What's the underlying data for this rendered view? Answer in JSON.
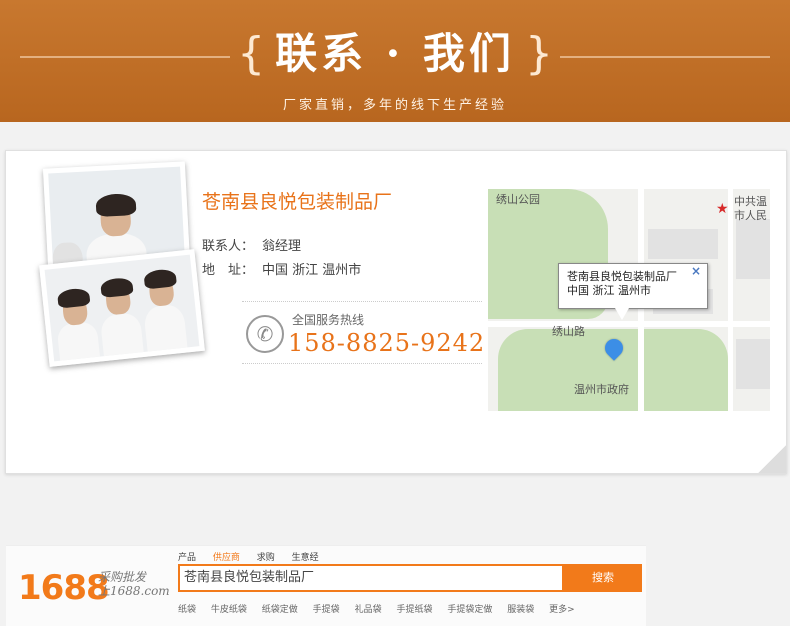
{
  "banner": {
    "title": "联系 · 我们",
    "brace_left": "{",
    "brace_right": "}",
    "subtitle": "厂家直销，多年的线下生产经验"
  },
  "company": {
    "name": "苍南县良悦包装制品厂",
    "contact_label": "联系人：",
    "contact_value": "翁经理",
    "address_label": "地　址：",
    "address_value": "中国 浙江 温州市"
  },
  "hotline": {
    "label": "全国服务热线",
    "number": "158-8825-9242",
    "icon": "phone-icon"
  },
  "map": {
    "popup_line1": "苍南县良悦包装制品厂",
    "popup_line2": "中国 浙江 温州市",
    "close": "×",
    "labels": {
      "park": "绣山公园",
      "road": "绣山路",
      "gov": "温州市政府",
      "poi1": "中共温",
      "poi2": "市人民"
    }
  },
  "bar1688": {
    "logo": "1688",
    "slogan1": "采购批发",
    "slogan2": "上1688.com",
    "tabs": [
      "产品",
      "供应商",
      "求购",
      "生意经"
    ],
    "active_tab": 1,
    "search_value": "苍南县良悦包装制品厂",
    "search_button": "搜索",
    "hotwords": [
      "纸袋",
      "牛皮纸袋",
      "纸袋定做",
      "手提袋",
      "礼品袋",
      "手提纸袋",
      "手提袋定做",
      "服装袋",
      "更多>"
    ]
  },
  "colors": {
    "accent": "#e8731a",
    "banner": "#c0702a"
  }
}
